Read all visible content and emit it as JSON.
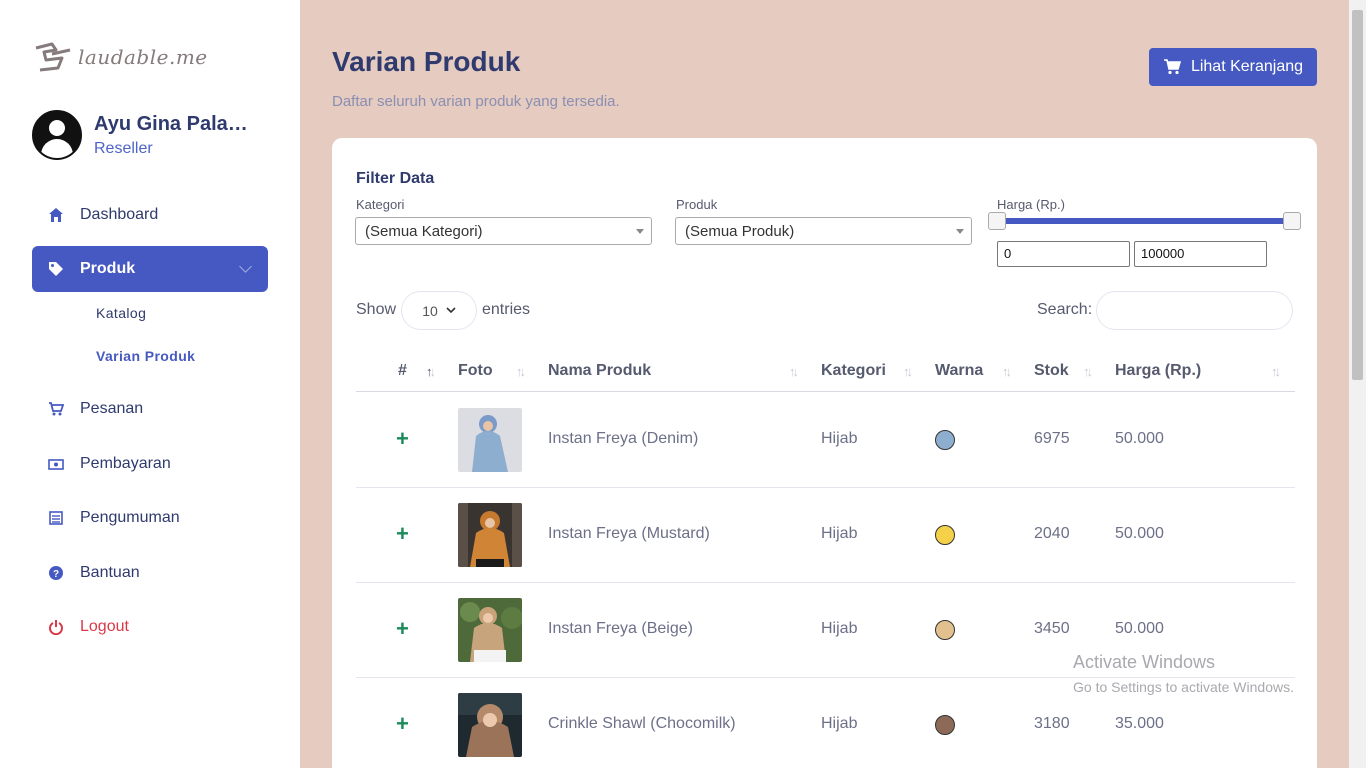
{
  "brand": {
    "logo_text": "laudable.me"
  },
  "user": {
    "name": "Ayu Gina Palas...",
    "role": "Reseller"
  },
  "nav": {
    "dashboard": "Dashboard",
    "produk": "Produk",
    "katalog": "Katalog",
    "varian": "Varian Produk",
    "pesanan": "Pesanan",
    "pembayaran": "Pembayaran",
    "pengumuman": "Pengumuman",
    "bantuan": "Bantuan",
    "logout": "Logout"
  },
  "header": {
    "title": "Varian Produk",
    "subtitle": "Daftar seluruh varian produk yang tersedia.",
    "cart_button": "Lihat Keranjang"
  },
  "filter": {
    "title": "Filter Data",
    "kategori_label": "Kategori",
    "kategori_value": "(Semua Kategori)",
    "produk_label": "Produk",
    "produk_value": "(Semua Produk)",
    "harga_label": "Harga (Rp.)",
    "harga_min": "0",
    "harga_max": "100000"
  },
  "table_controls": {
    "show_label": "Show",
    "entries_value": "10",
    "entries_label": "entries",
    "search_label": "Search:"
  },
  "table": {
    "headers": [
      "#",
      "Foto",
      "Nama Produk",
      "Kategori",
      "Warna",
      "Stok",
      "Harga (Rp.)"
    ],
    "rows": [
      {
        "expand": "+",
        "name": "Instan Freya (Denim)",
        "category": "Hijab",
        "color": "#8eaed0",
        "stock": "6975",
        "price": "50.000"
      },
      {
        "expand": "+",
        "name": "Instan Freya (Mustard)",
        "category": "Hijab",
        "color": "#f5d14a",
        "stock": "2040",
        "price": "50.000"
      },
      {
        "expand": "+",
        "name": "Instan Freya (Beige)",
        "category": "Hijab",
        "color": "#e2c18e",
        "stock": "3450",
        "price": "50.000"
      },
      {
        "expand": "+",
        "name": "Crinkle Shawl (Chocomilk)",
        "category": "Hijab",
        "color": "#8c6a57",
        "stock": "3180",
        "price": "35.000"
      }
    ]
  },
  "watermark": {
    "line1": "Activate Windows",
    "line2": "Go to Settings to activate Windows."
  }
}
